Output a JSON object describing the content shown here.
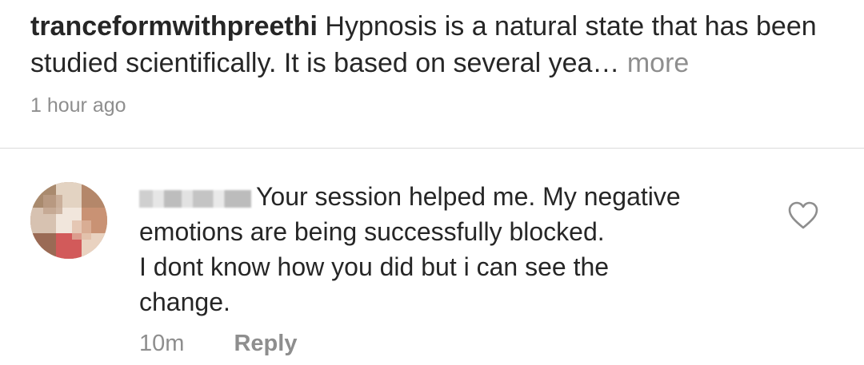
{
  "caption": {
    "username": "tranceformwithpreethi",
    "text": "Hypnosis is a natural state that has been studied scientifically. It is based on several yea",
    "ellipsis": "…",
    "more_label": "more",
    "time": "1 hour ago"
  },
  "comment": {
    "lines": [
      "Your session helped me. My negative",
      "emotions are being successfully blocked.",
      "I dont know how you did but i can see the",
      "change."
    ],
    "time": "10m",
    "reply_label": "Reply",
    "like_icon": "heart-outline-icon"
  },
  "colors": {
    "text": "#262626",
    "secondary": "#8e8e8e",
    "divider": "#dbdbdb"
  }
}
